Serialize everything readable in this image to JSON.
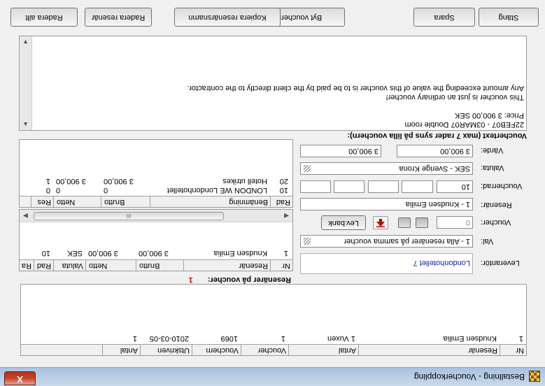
{
  "window": {
    "title": "Bestallning - Voucherkoppling",
    "close_label": "X"
  },
  "top_table": {
    "columns": [
      "Nr",
      "Resenär",
      "Antal",
      "Voucher",
      "Vouchern",
      "Utskriven",
      "Antal"
    ],
    "rows": [
      {
        "nr": "1",
        "resenar": "Knudsen Emilia",
        "antal": "1 Vuxen",
        "voucher": "1",
        "vouchern": "1069",
        "utskriven": "2010-03-05",
        "antal2": "1"
      }
    ]
  },
  "form": {
    "leverantor_label": "Leverantör:",
    "leverantor_value": "Londonhotellet 7",
    "val_label": "Val:",
    "val_value": "1 - Alla resenärer på samma voucher",
    "voucher_label": "Voucher:",
    "voucher_value": "0",
    "lev_bank_label": "Lev.bank",
    "resenar_label": "Resenär:",
    "resenar_value": "1 - Knudsen Emilia",
    "voucherrad_label": "Voucherrad:",
    "voucherrad_value": "10",
    "valuta_label": "Valuta:",
    "valuta_value": "SEK - Sverige Krona",
    "varde_label": "Värde:",
    "varde_value": "3 900,00",
    "varde_value2": "3 900,00",
    "vouchertext_label": "Vouchertext (max 7 rader syns på lilla vouchern):"
  },
  "resenarer_pa_voucher": {
    "label": "Resenärer på voucher:",
    "count": "1",
    "columns": [
      "Nr",
      "Resenär",
      "Brutto",
      "Netto",
      "Valuta",
      "Rad",
      "Ra"
    ],
    "rows": [
      {
        "nr": "1",
        "resenar": "Knudsen Emilia",
        "brutto": "3 900,00",
        "netto": "3 900,00",
        "valuta": "SEK",
        "rad": "10"
      }
    ]
  },
  "rad_table": {
    "columns": [
      "Rad",
      "Benämning",
      "Brutto",
      "Netto",
      "Res"
    ],
    "rows": [
      {
        "rad": "10",
        "benamning": "LONDON WE Londonhotellet",
        "brutto": "0",
        "netto": "0",
        "res": "0"
      },
      {
        "rad": "20",
        "benamning": "Hotell utrikes",
        "brutto": "3 900,00",
        "netto": "3 900,00",
        "res": "1"
      }
    ]
  },
  "vouchertext": {
    "lines": [
      "22FEB07 - 03MAR07 Double room",
      "Price: 3 900,00 SEK",
      "",
      "This voucher is just an ordinary voucher!",
      "Any amount exceeding the value of this voucher is to be paid by the client directly to the contractor."
    ]
  },
  "buttons": {
    "stang": "Stäng",
    "spara": "Spara",
    "byt_vouchermall": "Byt vouchermall",
    "kopiera": "Kopiera resenärsnamn",
    "radera_resenar": "Radera resenär",
    "radera_allt": "Radera allt"
  },
  "scroll_thumb_glyph": "III"
}
